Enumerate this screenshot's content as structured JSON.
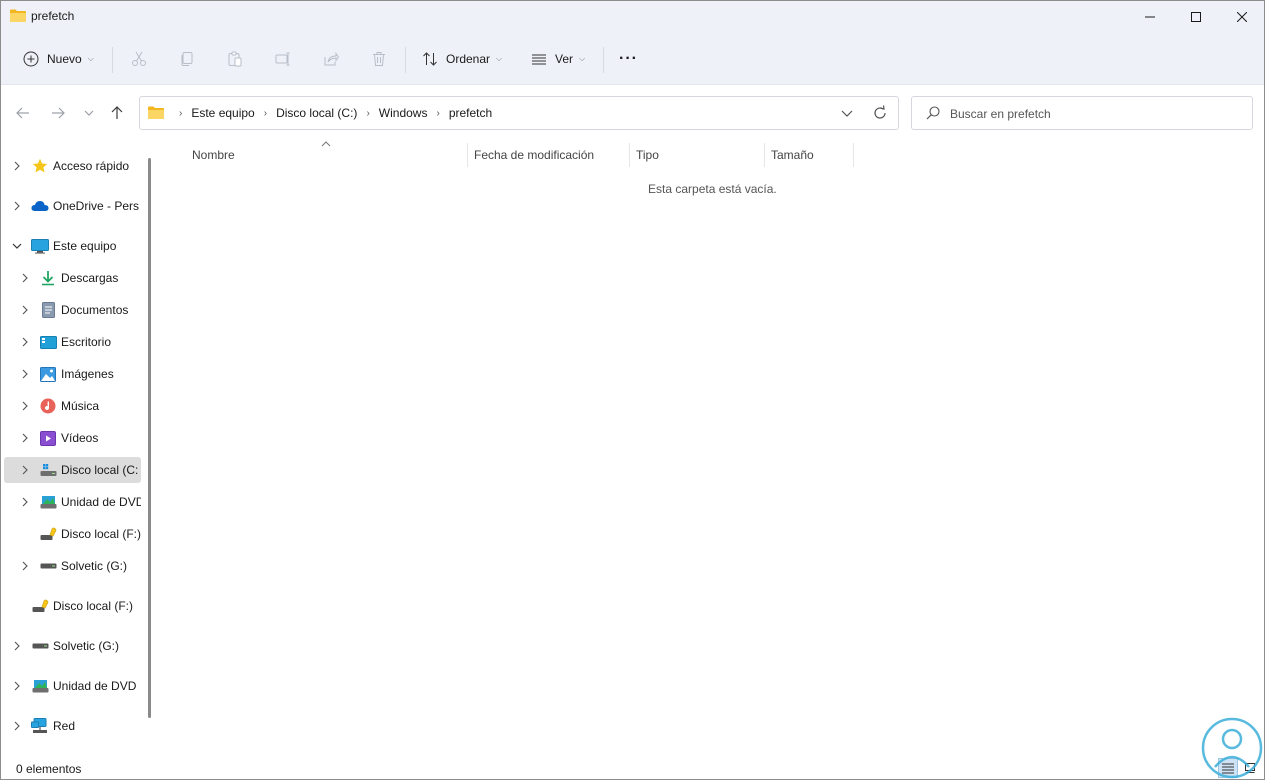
{
  "window": {
    "title": "prefetch",
    "controls": {
      "minimize": "minimize-icon",
      "maximize": "maximize-icon",
      "close": "close-icon"
    }
  },
  "commandbar": {
    "new_label": "Nuevo",
    "sort_label": "Ordenar",
    "view_label": "Ver",
    "more_label": "···",
    "icons": [
      "cut-icon",
      "copy-icon",
      "paste-icon",
      "rename-icon",
      "share-icon",
      "delete-icon"
    ]
  },
  "address": {
    "crumbs": [
      "Este equipo",
      "Disco local (C:)",
      "Windows",
      "prefetch"
    ],
    "search_placeholder": "Buscar en prefetch"
  },
  "navpane": {
    "items": [
      {
        "label": "Acceso rápido",
        "icon": "star-icon",
        "expander": "collapsed"
      },
      {
        "label": "OneDrive - Pers",
        "icon": "cloud-icon",
        "expander": "collapsed"
      },
      {
        "label": "Este equipo",
        "icon": "monitor-icon",
        "expander": "expanded"
      },
      {
        "label": "Descargas",
        "icon": "download-icon",
        "expander": "collapsed"
      },
      {
        "label": "Documentos",
        "icon": "document-icon",
        "expander": "collapsed"
      },
      {
        "label": "Escritorio",
        "icon": "desktop-icon",
        "expander": "collapsed"
      },
      {
        "label": "Imágenes",
        "icon": "image-icon",
        "expander": "collapsed"
      },
      {
        "label": "Música",
        "icon": "music-icon",
        "expander": "collapsed"
      },
      {
        "label": "Vídeos",
        "icon": "video-icon",
        "expander": "collapsed"
      },
      {
        "label": "Disco local (C:",
        "icon": "windows-drive-icon",
        "expander": "collapsed",
        "selected": true
      },
      {
        "label": "Unidad de DVD",
        "icon": "dvd-drive-icon",
        "expander": "collapsed"
      },
      {
        "label": "Disco local (F:)",
        "icon": "usb-drive-icon",
        "expander": "none"
      },
      {
        "label": "Solvetic (G:)",
        "icon": "drive-icon",
        "expander": "collapsed"
      },
      {
        "label": "Disco local (F:)",
        "icon": "usb-drive-icon",
        "expander": "none"
      },
      {
        "label": "Solvetic (G:)",
        "icon": "drive-icon",
        "expander": "collapsed"
      },
      {
        "label": "Unidad de DVD",
        "icon": "dvd-drive-icon",
        "expander": "collapsed"
      },
      {
        "label": "Red",
        "icon": "network-icon",
        "expander": "collapsed"
      }
    ]
  },
  "content": {
    "columns": [
      "Nombre",
      "Fecha de modificación",
      "Tipo",
      "Tamaño"
    ],
    "sorted_column": "Nombre",
    "empty_message": "Esta carpeta está vacía."
  },
  "statusbar": {
    "item_count": "0 elementos",
    "view_modes": [
      "details-view-icon",
      "large-icons-view-icon"
    ],
    "active_view": "details-view-icon"
  },
  "colors": {
    "chrome_bg": "#eef2f8",
    "folder_yellow": "#f7c948",
    "selection_gray": "#dcdcdc",
    "accent_blue": "#0067c0"
  }
}
